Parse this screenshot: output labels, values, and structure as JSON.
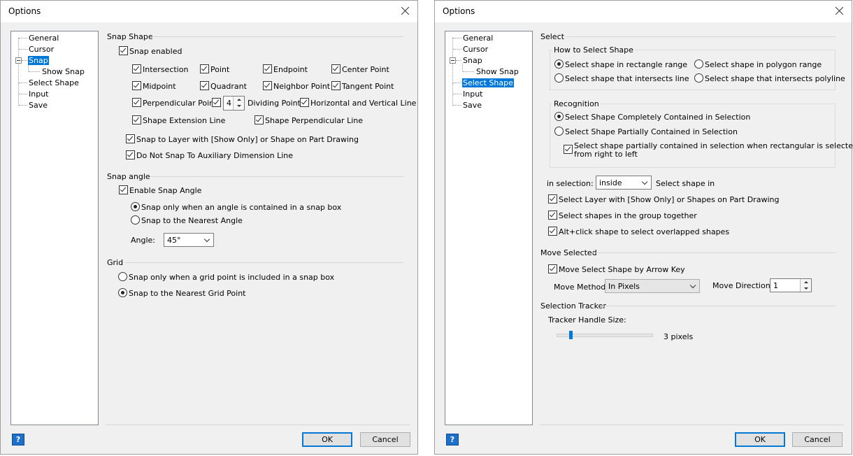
{
  "dialog1": {
    "title": "Options",
    "tree": [
      "General",
      "Cursor",
      "Snap",
      "Show Snap",
      "Select Shape",
      "Input",
      "Save"
    ],
    "snap_shape": {
      "title": "Snap Shape",
      "snap_enabled": "Snap enabled",
      "options": {
        "intersection": "Intersection",
        "point": "Point",
        "endpoint": "Endpoint",
        "center_point": "Center Point",
        "midpoint": "Midpoint",
        "quadrant": "Quadrant",
        "neighbor_point": "Neighbor Point",
        "tangent_point": "Tangent Point",
        "perpendicular_point": "Perpendicular Point",
        "dividing_value": "4",
        "dividing_point": "Dividing Point",
        "horizontal_vertical": "Horizontal and Vertical Line",
        "shape_extension": "Shape Extension Line",
        "shape_perpendicular": "Shape Perpendicular Line"
      },
      "snap_layer": "Snap to Layer with [Show Only] or Shape on Part Drawing",
      "no_aux_dim": "Do Not Snap To Auxiliary Dimension Line"
    },
    "snap_angle": {
      "title": "Snap angle",
      "enable": "Enable Snap Angle",
      "radio_contained": "Snap only when an angle is contained in a snap box",
      "radio_nearest": "Snap to the Nearest Angle",
      "angle_label": "Angle:",
      "angle_value": "45°"
    },
    "grid": {
      "title": "Grid",
      "radio_included": "Snap only when a grid point is included in a snap box",
      "radio_nearest": "Snap to the Nearest Grid Point"
    },
    "ok": "OK",
    "cancel": "Cancel",
    "help": "?"
  },
  "dialog2": {
    "title": "Options",
    "tree": [
      "General",
      "Cursor",
      "Snap",
      "Show Snap",
      "Select Shape",
      "Input",
      "Save"
    ],
    "select": {
      "title": "Select",
      "how_title": "How to Select Shape",
      "rect": "Select shape in rectangle range",
      "polygon": "Select shape in polygon range",
      "intersects_line": "Select shape that intersects line",
      "intersects_polyline": "Select shape that intersects polyline",
      "recognition_title": "Recognition",
      "completely": "Select Shape Completely Contained in Selection",
      "partially": "Select Shape Partially Contained in Selection",
      "partially_rtl_line1": "Select shape partially contained in selection when rectangular is selected",
      "partially_rtl_line2": "from right to left",
      "in_selection_label": "in selection:",
      "in_selection_value": "inside",
      "in_selection_suffix": "Select shape in",
      "layer": "Select Layer with [Show Only] or Shapes on Part Drawing",
      "group": "Select shapes in the group together",
      "altclick": "Alt+click shape to select overlapped shapes"
    },
    "move": {
      "title": "Move Selected",
      "arrow": "Move Select Shape by Arrow Key",
      "method_label": "Move Method:",
      "method_value": "In Pixels",
      "direction_label": "Move Direction:",
      "direction_value": "1"
    },
    "tracker": {
      "title": "Selection Tracker",
      "handle_label": "Tracker Handle Size:",
      "handle_value": "3 pixels",
      "handle_level": 0.15
    },
    "ok": "OK",
    "cancel": "Cancel",
    "help": "?"
  }
}
